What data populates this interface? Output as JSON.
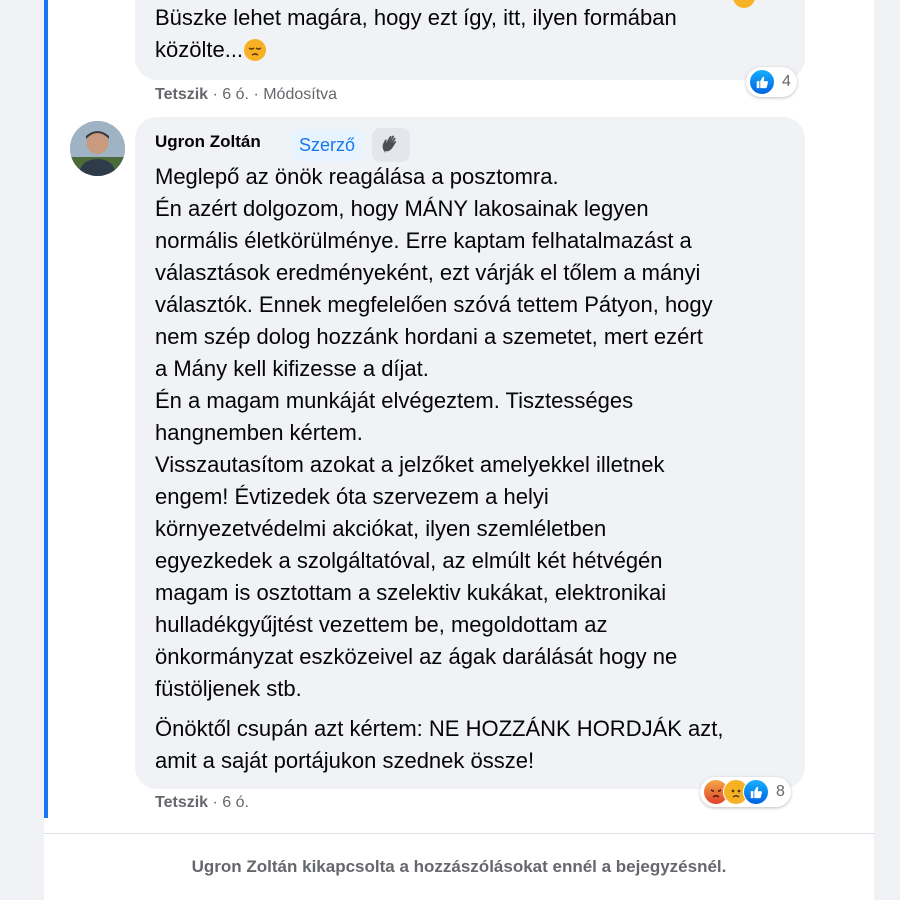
{
  "comments": [
    {
      "text": "Büszke lehet magára, hogy ezt így, itt, ilyen formában\nközölte...",
      "emoji": "pensive-face",
      "like_label": "Tetszik",
      "time": "6 ó.",
      "edited_label": "Módosítva",
      "reaction_count": "4",
      "reactions": [
        "like"
      ]
    },
    {
      "author": "Ugron Zoltán",
      "author_badge": "Szerző",
      "paragraph1": "Meglepő az önök reagálása a posztomra.\nÉn azért dolgozom, hogy MÁNY lakosainak legyen\nnormális életkörülménye. Erre kaptam felhatalmazást a\nválasztások eredményeként, ezt várják el tőlem a mányi\nválasztók. Ennek megfelelően szóvá tettem Pátyon, hogy\nnem szép dolog hozzánk hordani a szemetet, mert ezért\na Mány kell kifizesse a díjat.\nÉn a magam munkáját elvégeztem. Tisztességes\nhangnemben kértem.\nVisszautasítom azokat a jelzőket amelyekkel illetnek\nengem! Évtizedek óta szervezem a helyi\nkörnyezetvédelmi akciókat, ilyen szemléletben\negyezkedek a szolgáltatóval, az elmúlt két hétvégén\nmagam is osztottam a szelektiv kukákat, elektronikai\nhulladékgyűjtést vezettem be, megoldottam az\nönkormányzat eszközeivel az ágak darálását hogy ne\nfüstöljenek stb.",
      "paragraph2": "Önöktől csupán azt kértem: NE HOZZÁNK HORDJÁK azt,\namit a saját portájukon szednek össze!",
      "like_label": "Tetszik",
      "time": "6 ó.",
      "reaction_count": "8",
      "reactions": [
        "angry",
        "sad",
        "like"
      ]
    }
  ],
  "separator": "·",
  "footer_notice": "Ugron Zoltán kikapcsolta a hozzászólásokat ennél a bejegyzésnél.",
  "colors": {
    "accent": "#1877f2",
    "bubble": "#f0f2f5",
    "meta_text": "#65676b"
  }
}
